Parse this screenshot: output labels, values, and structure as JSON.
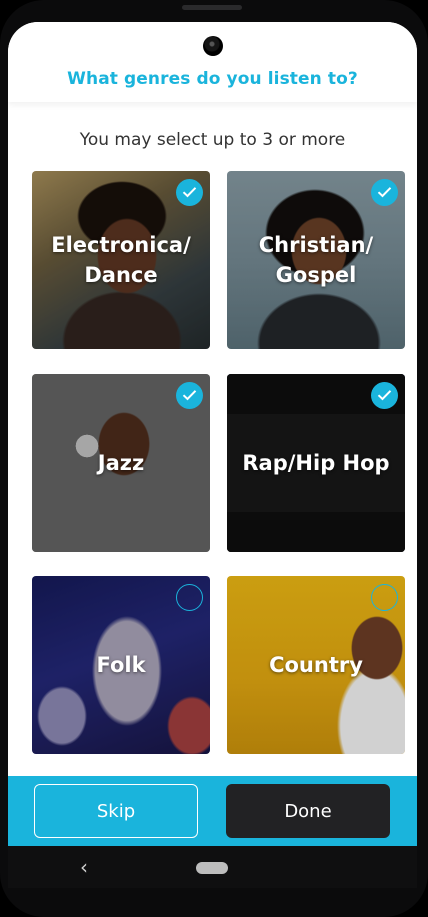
{
  "header": {
    "title": "What genres do you listen to?"
  },
  "subtitle": "You may select up to 3 or more",
  "genres": [
    {
      "label": "Electronica/\nDance",
      "selected": true,
      "image": "person-smiling-eyes-closed"
    },
    {
      "label": "Christian/\nGospel",
      "selected": true,
      "image": "person-with-headphones"
    },
    {
      "label": "Jazz",
      "selected": true,
      "image": "man-with-headphones-sunglasses"
    },
    {
      "label": "Rap/Hip Hop",
      "selected": true,
      "image": "boombox-graffiti"
    },
    {
      "label": "Folk",
      "selected": false,
      "image": "concert-crowd-blue"
    },
    {
      "label": "Country",
      "selected": false,
      "image": "man-laughing-yellow-wall"
    }
  ],
  "footer": {
    "skip_label": "Skip",
    "done_label": "Done"
  },
  "nav": {
    "back_icon": "‹",
    "home_icon": "home-pill-icon"
  },
  "colors": {
    "accent": "#1ab4dc",
    "done_button": "#222224",
    "nav_bar": "#0f0f10"
  }
}
